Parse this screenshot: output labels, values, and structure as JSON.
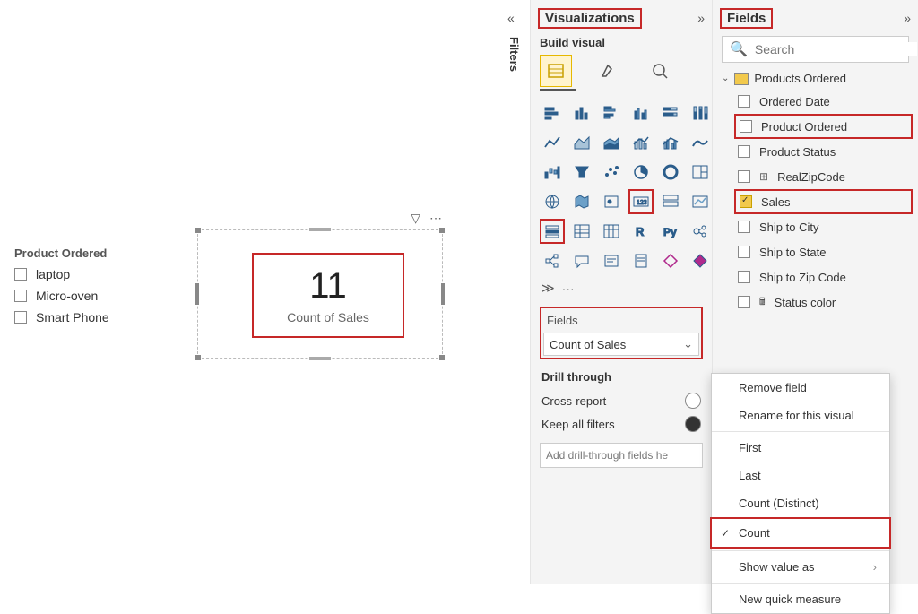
{
  "canvas": {
    "slicer": {
      "title": "Product Ordered",
      "items": [
        "laptop",
        "Micro-oven",
        "Smart Phone"
      ]
    },
    "card": {
      "value": "11",
      "label": "Count of Sales",
      "toolbar_filter_icon": "filter-icon",
      "toolbar_more_icon": "more-icon"
    }
  },
  "filters_tab": "Filters",
  "visualizations": {
    "title": "Visualizations",
    "build_label": "Build visual",
    "more_label": "···",
    "field_well": {
      "label": "Fields",
      "value": "Count of Sales"
    },
    "drill": {
      "title": "Drill through",
      "cross_report": "Cross-report",
      "keep_filters": "Keep all filters",
      "placeholder": "Add drill-through fields he"
    }
  },
  "fields": {
    "title": "Fields",
    "search_placeholder": "Search",
    "table": "Products Ordered",
    "columns": [
      {
        "name": "Ordered Date",
        "checked": false,
        "hl": false,
        "icon": ""
      },
      {
        "name": "Product Ordered",
        "checked": false,
        "hl": true,
        "icon": ""
      },
      {
        "name": "Product Status",
        "checked": false,
        "hl": false,
        "icon": ""
      },
      {
        "name": "RealZipCode",
        "checked": false,
        "hl": false,
        "icon": "geo"
      },
      {
        "name": "Sales",
        "checked": true,
        "hl": true,
        "icon": ""
      },
      {
        "name": "Ship to City",
        "checked": false,
        "hl": false,
        "icon": ""
      },
      {
        "name": "Ship to State",
        "checked": false,
        "hl": false,
        "icon": ""
      },
      {
        "name": "Ship to Zip Code",
        "checked": false,
        "hl": false,
        "icon": ""
      },
      {
        "name": "Status color",
        "checked": false,
        "hl": false,
        "icon": "calc"
      }
    ]
  },
  "context_menu": {
    "items": [
      {
        "label": "Remove field",
        "type": "item"
      },
      {
        "label": "Rename for this visual",
        "type": "item"
      },
      {
        "type": "sep"
      },
      {
        "label": "First",
        "type": "item"
      },
      {
        "label": "Last",
        "type": "item"
      },
      {
        "label": "Count (Distinct)",
        "type": "item"
      },
      {
        "label": "Count",
        "type": "item",
        "checked": true,
        "hl": true
      },
      {
        "type": "sep"
      },
      {
        "label": "Show value as",
        "type": "item",
        "submenu": true
      },
      {
        "type": "sep"
      },
      {
        "label": "New quick measure",
        "type": "item"
      }
    ]
  }
}
